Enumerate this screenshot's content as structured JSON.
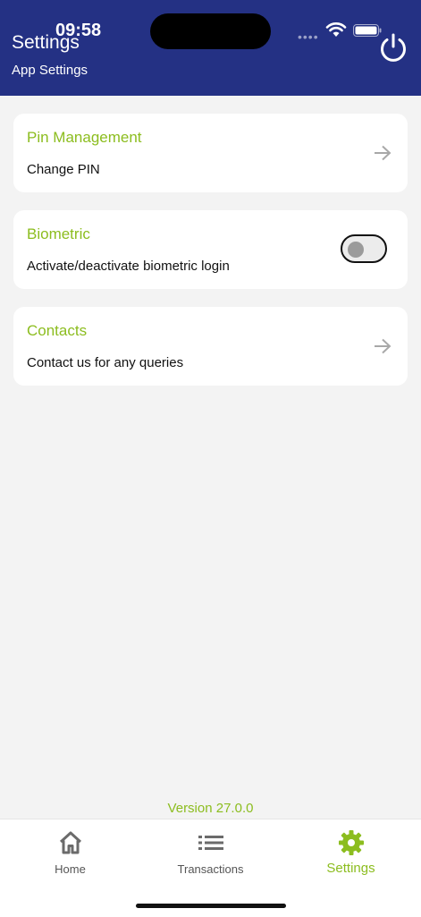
{
  "status_bar": {
    "time": "09:58",
    "signal": "••••"
  },
  "header": {
    "title": "Settings",
    "subtitle": "App Settings"
  },
  "cards": [
    {
      "title": "Pin Management",
      "description": "Change PIN"
    },
    {
      "title": "Biometric",
      "description": "Activate/deactivate biometric login",
      "toggle_on": false
    },
    {
      "title": "Contacts",
      "description": "Contact us for any queries"
    }
  ],
  "version": "Version 27.0.0",
  "tabs": [
    {
      "label": "Home",
      "icon": "home-icon"
    },
    {
      "label": "Transactions",
      "icon": "list-icon"
    },
    {
      "label": "Settings",
      "icon": "gear-icon",
      "active": true
    }
  ],
  "colors": {
    "header": "#243184",
    "accent": "#8cbd1f",
    "background": "#f3f3f3"
  }
}
